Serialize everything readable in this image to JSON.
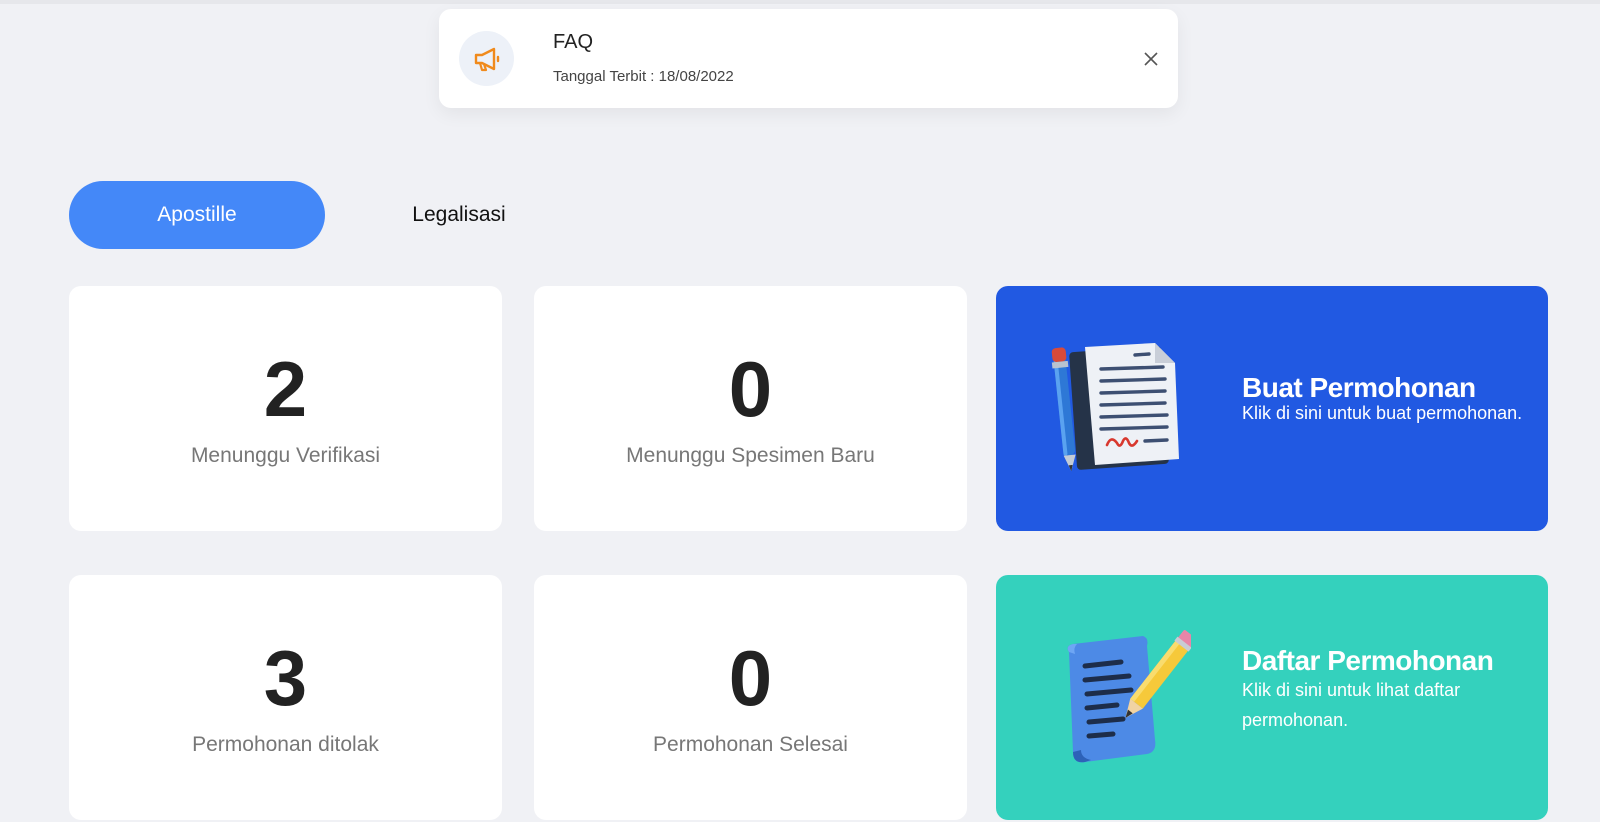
{
  "notice": {
    "icon": "megaphone-icon",
    "title": "FAQ",
    "date": "Tanggal Terbit : 18/08/2022",
    "close_icon": "close-icon"
  },
  "tabs": [
    {
      "label": "Apostille",
      "active": true
    },
    {
      "label": "Legalisasi",
      "active": false
    }
  ],
  "stats": [
    {
      "value": "2",
      "label": "Menunggu Verifikasi"
    },
    {
      "value": "0",
      "label": "Menunggu Spesimen Baru"
    },
    {
      "value": "3",
      "label": "Permohonan ditolak"
    },
    {
      "value": "0",
      "label": "Permohonan Selesai"
    }
  ],
  "actions": [
    {
      "title": "Buat Permohonan",
      "description": "Klik di sini untuk buat permohonan.",
      "icon": "signed-document-icon",
      "color": "#2159e2"
    },
    {
      "title": "Daftar Permohonan",
      "description": "Klik di sini untuk lihat daftar permohonan.",
      "icon": "document-list-pencil-icon",
      "color": "#34d1bd"
    }
  ],
  "colors": {
    "background": "#f0f1f5",
    "accent": "#4488f8",
    "notice_icon": "#f08a1c"
  }
}
